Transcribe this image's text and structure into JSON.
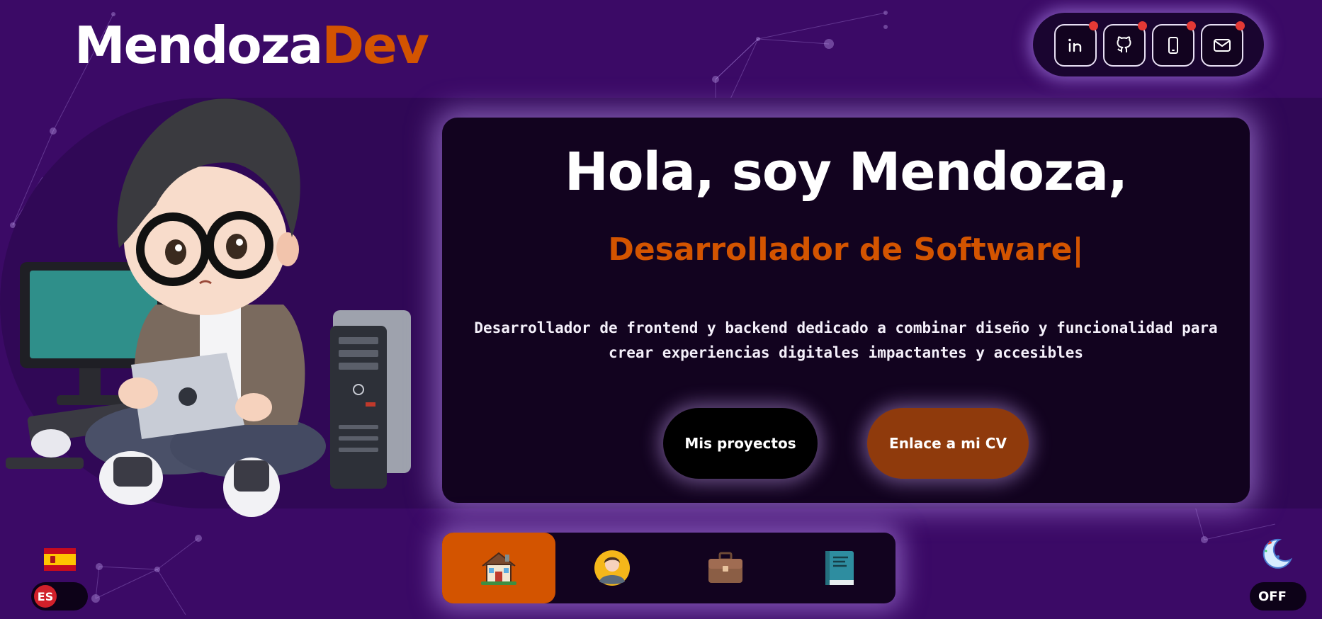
{
  "brand": {
    "part1": "Mendoza",
    "part2": "Dev"
  },
  "social": [
    {
      "name": "linkedin"
    },
    {
      "name": "github"
    },
    {
      "name": "phone"
    },
    {
      "name": "email"
    }
  ],
  "hero": {
    "title": "Hola, soy Mendoza,",
    "role": "Desarrollador de Software|",
    "description": "Desarrollador de frontend y backend dedicado a combinar diseño y funcionalidad para crear experiencias digitales impactantes y accesibles",
    "btn_projects": "Mis proyectos",
    "btn_cv": "Enlace a mi CV"
  },
  "nav": [
    {
      "icon": "house-icon",
      "active": true
    },
    {
      "icon": "user-avatar-icon",
      "active": false
    },
    {
      "icon": "briefcase-icon",
      "active": false
    },
    {
      "icon": "book-icon",
      "active": false
    }
  ],
  "language": {
    "code": "ES"
  },
  "theme": {
    "label": "OFF"
  },
  "colors": {
    "background": "#3b0a66",
    "accent": "#d35400",
    "card": "#12031f"
  }
}
